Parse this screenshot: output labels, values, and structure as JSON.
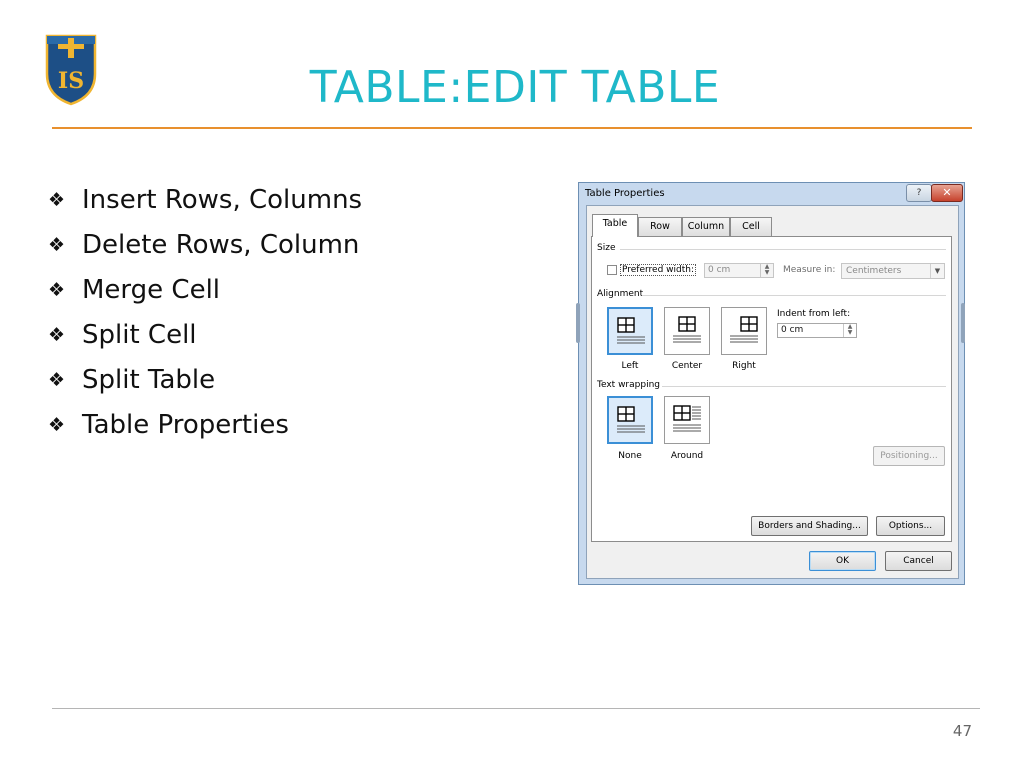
{
  "slide": {
    "title": "TABLE:EDIT TABLE",
    "page_number": "47",
    "colors": {
      "title": "#1fb8c9",
      "rule": "#e8902e",
      "logo_shield": "#1d4f86",
      "logo_accent": "#f0b531"
    }
  },
  "logo": {
    "text": "IS"
  },
  "bullets": [
    "Insert Rows, Columns",
    "Delete Rows, Column",
    "Merge Cell",
    "Split Cell",
    "Split Table",
    "Table Properties"
  ],
  "dialog": {
    "title": "Table Properties",
    "help_label": "?",
    "close_label": "✕",
    "tabs": [
      "Table",
      "Row",
      "Column",
      "Cell"
    ],
    "size": {
      "label": "Size",
      "preferred_width_label": "Preferred width:",
      "preferred_width_value": "0 cm",
      "measure_in_label": "Measure in:",
      "measure_in_value": "Centimeters"
    },
    "alignment": {
      "label": "Alignment",
      "options": [
        "Left",
        "Center",
        "Right"
      ],
      "indent_label": "Indent from left:",
      "indent_value": "0 cm"
    },
    "text_wrapping": {
      "label": "Text wrapping",
      "options": [
        "None",
        "Around"
      ]
    },
    "buttons": {
      "positioning": "Positioning...",
      "borders": "Borders and Shading...",
      "options": "Options...",
      "ok": "OK",
      "cancel": "Cancel"
    }
  }
}
